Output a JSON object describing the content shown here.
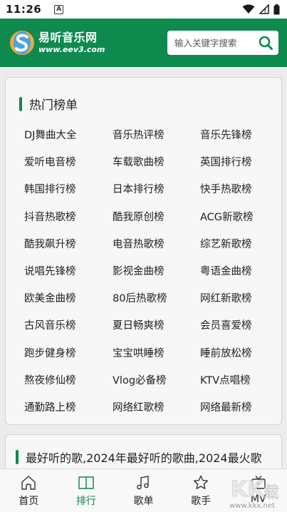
{
  "status_bar": {
    "time": "11:26",
    "notification_letter": "A"
  },
  "header": {
    "logo": {
      "name": "易听音乐网",
      "url_text": "www.eev3.com"
    },
    "search": {
      "placeholder": "输入关键字搜索",
      "icon": "search-icon"
    }
  },
  "ranking_card": {
    "title": "热门榜单",
    "items": [
      "DJ舞曲大全",
      "音乐热评榜",
      "音乐先锋榜",
      "爱听电音榜",
      "车载歌曲榜",
      "英国排行榜",
      "韩国排行榜",
      "日本排行榜",
      "快手热歌榜",
      "抖音热歌榜",
      "酷我原创榜",
      "ACG新歌榜",
      "酷我飙升榜",
      "电音热歌榜",
      "综艺新歌榜",
      "说唱先锋榜",
      "影视金曲榜",
      "粤语金曲榜",
      "欧美金曲榜",
      "80后热歌榜",
      "网红新歌榜",
      "古风音乐榜",
      "夏日畅爽榜",
      "会员喜爱榜",
      "跑步健身榜",
      "宝宝哄睡榜",
      "睡前放松榜",
      "熬夜修仙榜",
      "Vlog必备榜",
      "KTV点唱榜",
      "通勤路上榜",
      "网络红歌榜",
      "网络最新榜"
    ]
  },
  "next_card": {
    "title": "最好听的歌,2024年最好听的歌曲,2024最火歌"
  },
  "bottom_nav": {
    "items": [
      {
        "label": "首页",
        "icon": "home-icon",
        "active": false
      },
      {
        "label": "排行",
        "icon": "book-icon",
        "active": true
      },
      {
        "label": "歌单",
        "icon": "music-note-icon",
        "active": false
      },
      {
        "label": "歌手",
        "icon": "star-icon",
        "active": false
      },
      {
        "label": "MV",
        "icon": "tv-icon",
        "active": false
      }
    ]
  },
  "watermark": {
    "text": "KK下载",
    "url": "www.kkx.net"
  },
  "colors": {
    "brand_green": "#0e8a4f",
    "background": "#ececec",
    "card": "#f7f7f7"
  }
}
